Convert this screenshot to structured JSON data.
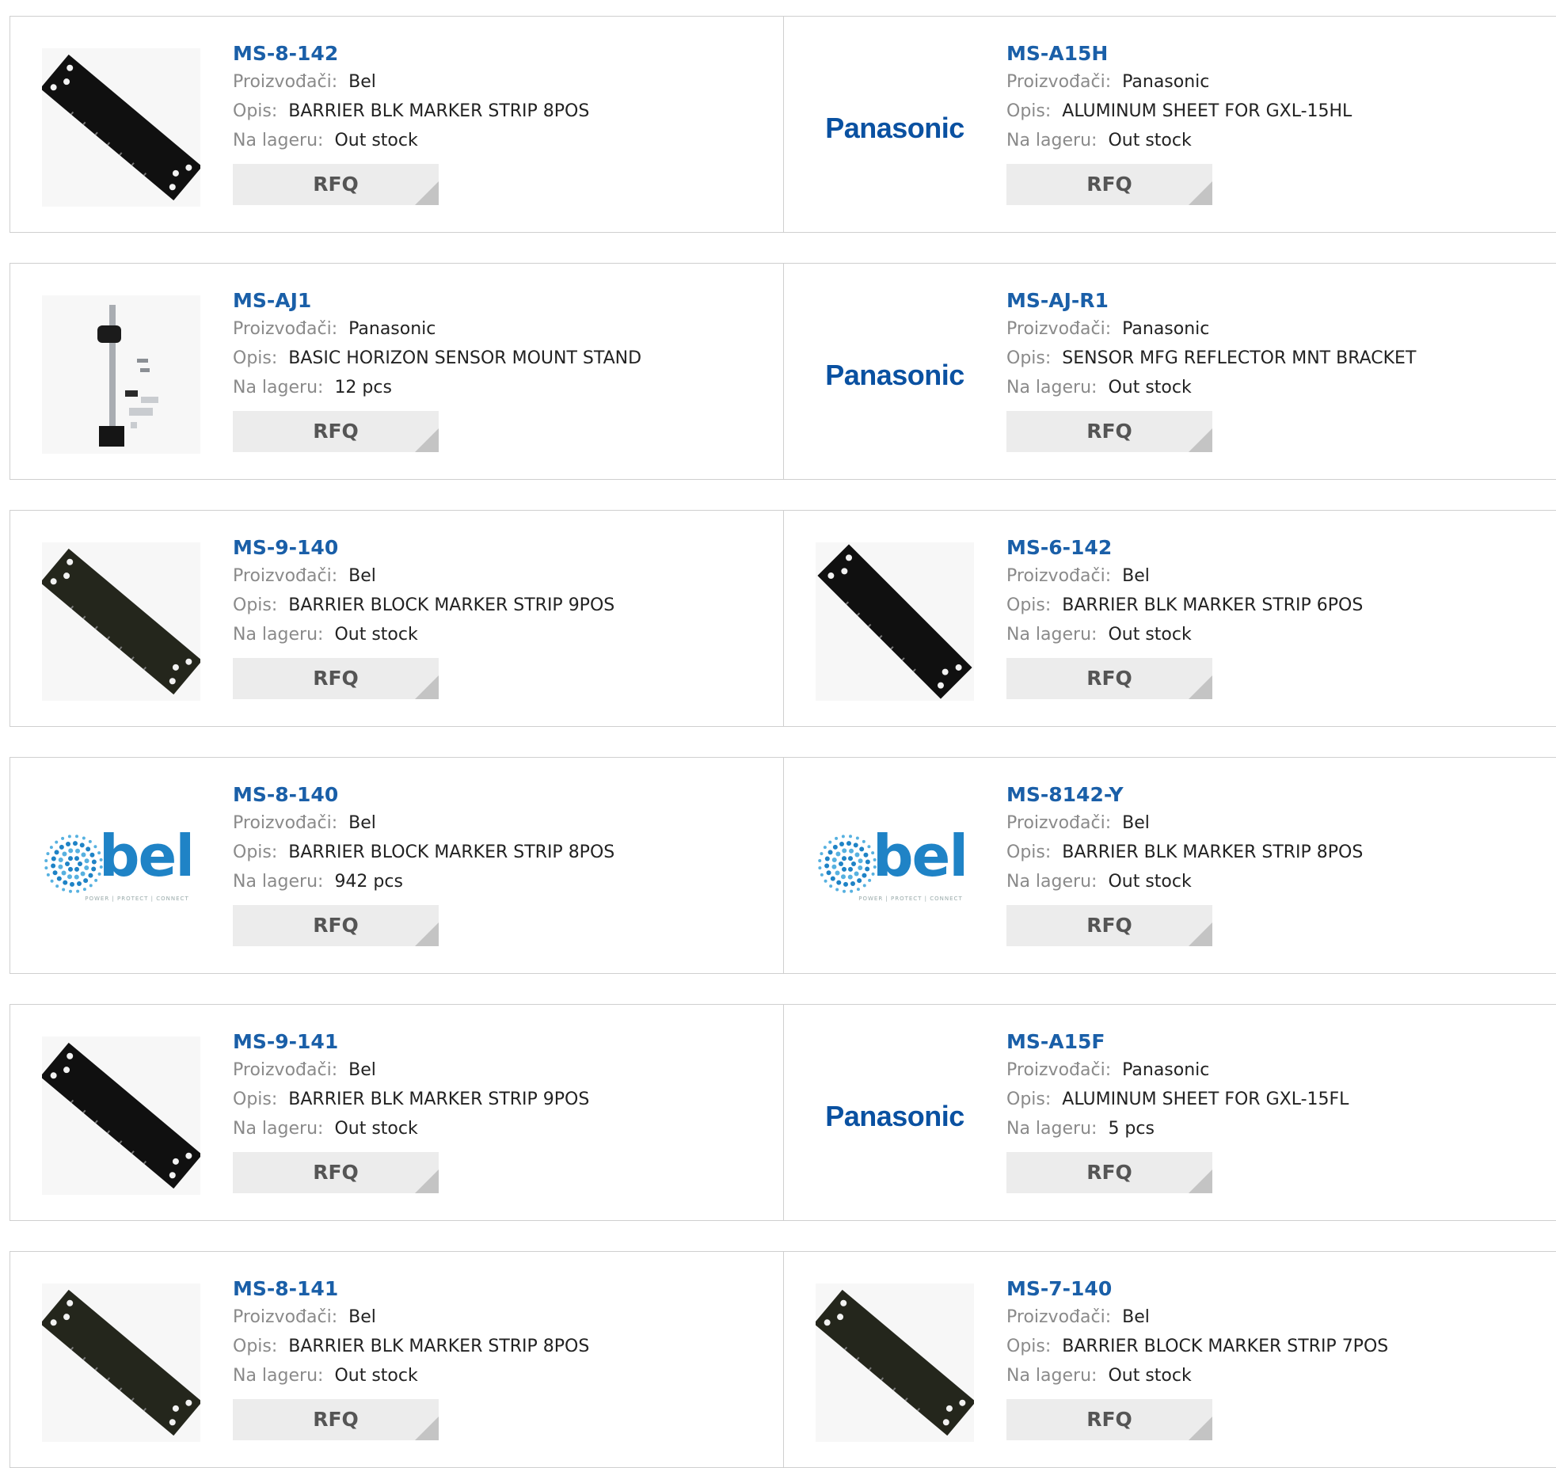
{
  "labels": {
    "manufacturer": "Proizvođači:",
    "description": "Opis:",
    "stock": "Na lageru:",
    "rfq": "RFQ"
  },
  "colors": {
    "part_number": "#1a5fa8",
    "label": "#8a8a8a",
    "rfq_bg": "#ececec",
    "border": "#cfcfcf",
    "panasonic": "#0a51a1",
    "bel": "#1f83c6"
  },
  "products": [
    {
      "part": "MS-8-142",
      "manufacturer": "Bel",
      "description": "BARRIER BLK MARKER STRIP 8POS",
      "stock": "Out stock",
      "image": "marker-strip-photo"
    },
    {
      "part": "MS-A15H",
      "manufacturer": "Panasonic",
      "description": "ALUMINUM SHEET FOR GXL-15HL",
      "stock": "Out stock",
      "image": "panasonic-logo"
    },
    {
      "part": "MS-AJ1",
      "manufacturer": "Panasonic",
      "description": "BASIC HORIZON SENSOR MOUNT STAND",
      "stock": "12 pcs",
      "image": "sensor-stand-photo"
    },
    {
      "part": "MS-AJ-R1",
      "manufacturer": "Panasonic",
      "description": "SENSOR MFG REFLECTOR MNT BRACKET",
      "stock": "Out stock",
      "image": "panasonic-logo"
    },
    {
      "part": "MS-9-140",
      "manufacturer": "Bel",
      "description": "BARRIER BLOCK MARKER STRIP 9POS",
      "stock": "Out stock",
      "image": "marker-strip-photo"
    },
    {
      "part": "MS-6-142",
      "manufacturer": "Bel",
      "description": "BARRIER BLK MARKER STRIP 6POS",
      "stock": "Out stock",
      "image": "marker-strip-photo"
    },
    {
      "part": "MS-8-140",
      "manufacturer": "Bel",
      "description": "BARRIER BLOCK MARKER STRIP 8POS",
      "stock": "942 pcs",
      "image": "bel-logo"
    },
    {
      "part": "MS-8142-Y",
      "manufacturer": "Bel",
      "description": "BARRIER BLK MARKER STRIP 8POS",
      "stock": "Out stock",
      "image": "bel-logo"
    },
    {
      "part": "MS-9-141",
      "manufacturer": "Bel",
      "description": "BARRIER BLK MARKER STRIP 9POS",
      "stock": "Out stock",
      "image": "marker-strip-photo"
    },
    {
      "part": "MS-A15F",
      "manufacturer": "Panasonic",
      "description": "ALUMINUM SHEET FOR GXL-15FL",
      "stock": "5 pcs",
      "image": "panasonic-logo"
    },
    {
      "part": "MS-8-141",
      "manufacturer": "Bel",
      "description": "BARRIER BLK MARKER STRIP 8POS",
      "stock": "Out stock",
      "image": "marker-strip-photo"
    },
    {
      "part": "MS-7-140",
      "manufacturer": "Bel",
      "description": "BARRIER BLOCK MARKER STRIP 7POS",
      "stock": "Out stock",
      "image": "marker-strip-photo"
    }
  ],
  "logos": {
    "panasonic": "Panasonic",
    "bel": "bel",
    "bel_tagline": "POWER | PROTECT | CONNECT"
  }
}
